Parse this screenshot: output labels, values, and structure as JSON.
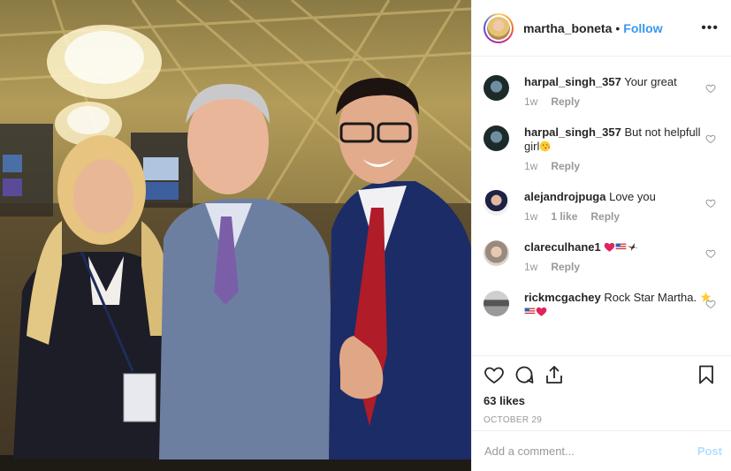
{
  "post": {
    "username": "martha_boneta",
    "dot": "•",
    "follow_label": "Follow",
    "more_icon": "more-horizontal-icon",
    "photo_alt": "Three people posing together in a hotel atrium"
  },
  "comments": [
    {
      "user": "harpal_singh_357",
      "text": "Your great",
      "time": "1w",
      "likes": "",
      "reply": "Reply",
      "emoji": []
    },
    {
      "user": "harpal_singh_357",
      "text": "But not helpfull girl",
      "time": "1w",
      "likes": "",
      "reply": "Reply",
      "emoji": [
        "kissing-face-emoji"
      ]
    },
    {
      "user": "alejandrojpuga",
      "text": "Love you",
      "time": "1w",
      "likes": "1 like",
      "reply": "Reply",
      "emoji": []
    },
    {
      "user": "clareculhane1",
      "text": "",
      "time": "1w",
      "likes": "",
      "reply": "Reply",
      "emoji": [
        "red-heart-emoji",
        "us-flag-emoji",
        "eagle-emoji"
      ]
    },
    {
      "user": "rickmcgachey",
      "text": "Rock Star Martha.",
      "time": "",
      "likes": "",
      "reply": "",
      "emoji": [
        "star-emoji",
        "us-flag-emoji",
        "red-heart-emoji"
      ]
    }
  ],
  "actions": {
    "like_icon": "heart-icon",
    "comment_icon": "comment-icon",
    "share_icon": "share-icon",
    "save_icon": "bookmark-icon",
    "likes_count": "63 likes",
    "date": "OCTOBER 29"
  },
  "add_comment": {
    "placeholder": "Add a comment...",
    "post_label": "Post"
  },
  "colors": {
    "link": "#3897f0",
    "post_disabled": "#b2dffc",
    "muted": "#999999",
    "text": "#262626"
  }
}
